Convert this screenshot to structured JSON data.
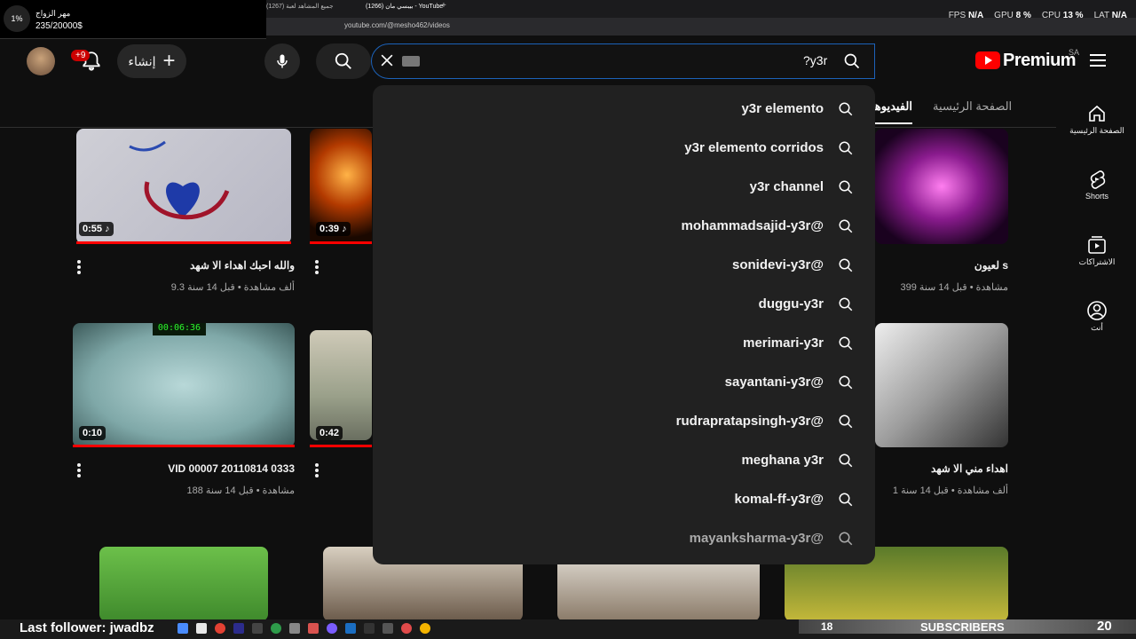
{
  "stream_widget": {
    "percent": "1%",
    "label": "مهر الزواج",
    "value": "235/20000$"
  },
  "browser": {
    "tabs": [
      "(1267) جميع المشاهد لعبة",
      "(1266) بيبسي مان - YouTube"
    ],
    "url": "youtube.com/@mesho462/videos"
  },
  "perf": {
    "fps_label": "FPS",
    "fps": "N/A",
    "gpu_label": "GPU",
    "gpu": "8 %",
    "cpu_label": "CPU",
    "cpu": "13 %",
    "lat_label": "LAT",
    "lat": "N/A"
  },
  "header": {
    "notifications_badge": "+9",
    "create_label": "إنشاء",
    "search_query": "?y3r",
    "logo_text": "Premium",
    "logo_region": "SA"
  },
  "suggestions": [
    "y3r elemento",
    "y3r elemento corridos",
    "y3r channel",
    "mohammadsajid-y3r@",
    "sonidevi-y3r@",
    "duggu-y3r",
    "merimari-y3r",
    "sayantani-y3r@",
    "rudrapratapsingh-y3r@",
    "meghana y3r",
    "komal-ff-y3r@",
    "mayanksharma-y3r@"
  ],
  "channel_tabs": {
    "home": "الصفحة الرئيسية",
    "videos": "الفيديوهات"
  },
  "sidebar": [
    {
      "label": "الصفحة الرئيسية",
      "icon": "home-icon"
    },
    {
      "label": "Shorts",
      "icon": "shorts-icon"
    },
    {
      "label": "الاشتراكات",
      "icon": "subscriptions-icon"
    },
    {
      "label": "أنت",
      "icon": "you-icon"
    }
  ],
  "videos": [
    {
      "duration": "0:55",
      "title": "والله احبك اهداء الا شهد",
      "meta": "9.3 ألف مشاهدة • قبل 14 سنة"
    },
    {
      "duration": "0:39",
      "title": "",
      "meta": ""
    },
    {
      "duration": "",
      "title": "لعيون s",
      "meta": "399 مشاهدة • قبل 14 سنة"
    },
    {
      "duration": "0:10",
      "title": "VID 00007 20110814 0333",
      "meta": "188 مشاهدة • قبل 14 سنة"
    },
    {
      "duration": "0:42",
      "title": "",
      "meta": ""
    },
    {
      "duration": "",
      "title": "اهداء مني الا شهد",
      "meta": "1 ألف مشاهدة • قبل 14 سنة"
    }
  ],
  "overlay": {
    "last_follower": "Last follower: jwadbz",
    "subs_label": "SUBSCRIBERS",
    "subs_current": "18",
    "subs_goal": "20"
  },
  "colors": {
    "accent": "#ff0000",
    "focus": "#1c62b9",
    "bg": "#0f0f0f",
    "dropdown": "#212121"
  }
}
